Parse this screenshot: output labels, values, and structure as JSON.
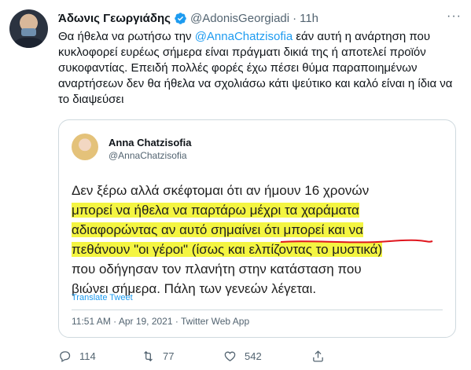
{
  "tweet": {
    "author_name": "Άδωνις Γεωργιάδης",
    "handle": "@AdonisGeorgiadi",
    "separator": "·",
    "time": "11h",
    "more": "···",
    "text_before_mention": "Θα ήθελα να ρωτήσω την ",
    "mention": "@AnnaChatzisofia",
    "text_after_mention": " εάν αυτή η ανάρτηση που κυκλοφορεί ευρέως σήμερα είναι πράγματι δικιά της ή αποτελεί προϊόν συκοφαντίας. Επειδή πολλές φορές έχω πέσει θύμα παραποιημένων αναρτήσεων δεν θα ήθελα να σχολιάσω κάτι ψεύτικο και καλό είναι η ίδια να το διαψεύσει"
  },
  "quoted": {
    "name": "Anna Chatzisofia",
    "handle": "@AnnaChatzisofia",
    "line1": "Δεν ξέρω αλλά σκέφτομαι ότι αν ήμουν 16 χρονών",
    "line2": "μπορεί να ήθελα να παρτάρω μέχρι τα χαράματα",
    "line3": "αδιαφορώντας αν αυτό σημαίνει ότι μπορεί και να",
    "line4a": "πεθάνουν \"οι γέροι\"",
    "line4b": " (ίσως και ελπίζοντας το μυστικά)",
    "line5": "που οδήγησαν τον πλανήτη στην κατάσταση που",
    "line6": "βιώνει σήμερα. Πάλη των γενεών λέγεται.",
    "translate": "Translate Tweet",
    "meta": "11:51 AM · Apr 19, 2021 · Twitter Web App"
  },
  "actions": {
    "replies": "114",
    "retweets": "77",
    "likes": "542"
  },
  "colors": {
    "link": "#1d9bf0",
    "highlight": "#f4f542",
    "underline": "#e0161e"
  }
}
